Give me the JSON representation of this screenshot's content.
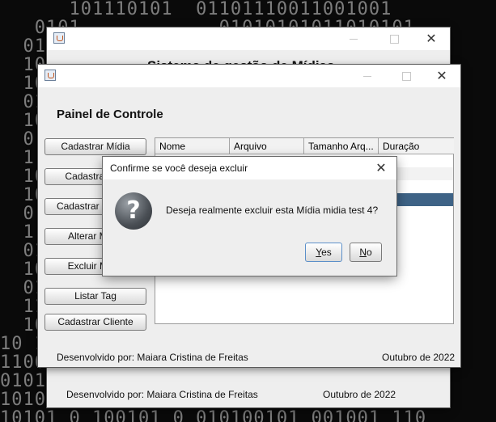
{
  "background": {
    "lines": [
      "      101110101  01101110011001001",
      "   0101            01010101011010101",
      "  01 1                            101",
      "  101                             010",
      "  10                              0 1",
      "  010                             101",
      "  10                              110",
      "  0 1                             011",
      "  1 0                             101",
      "  101                             010",
      "  10                              1 0",
      "  0 1                             101",
      "  1 0                             010",
      "  01                              101",
      "  10                              010",
      "  01                              101",
      "  11                              011",
      "  10                              101",
      "10 1                              010",
      "1100                              101",
      "0101 1 0  1 1 00 0 1 0100 0101 0 1 0",
      "1010 0010 0100101010 01 0 1010010 0 1",
      "10101 0 100101 0 010100101 001001 110"
    ]
  },
  "back_window": {
    "title": "Sistema de gestão de Mídias",
    "footer_left": "Desenvolvido por: Maiara Cristina de Freitas",
    "footer_right": "Outubro de 2022"
  },
  "main_window": {
    "heading": "Painel de Controle",
    "buttons": [
      "Cadastrar Mídia",
      "Cadastrar Tag",
      "Cadastrar Gênero",
      "Alterar Mídia",
      "Excluir Mídia",
      "Listar Tag",
      "Cadastrar Cliente"
    ],
    "table": {
      "columns": [
        "Nome",
        "Arquivo",
        "Tamanho Arq...",
        "Duração"
      ]
    },
    "footer_left": "Desenvolvido por: Maiara Cristina de Freitas",
    "footer_right": "Outubro de 2022"
  },
  "dialog": {
    "title": "Confirme se você deseja excluir",
    "message": "Deseja realmente excluir esta Mídia midia test 4?",
    "yes_label": "Yes",
    "yes_mnemonic": "Y",
    "yes_rest": "es",
    "no_label": "No",
    "no_mnemonic": "N",
    "no_rest": "o",
    "icon": "question-icon"
  },
  "colors": {
    "selection": "#3e6386",
    "yes_button_border": "#5b8fc9"
  }
}
